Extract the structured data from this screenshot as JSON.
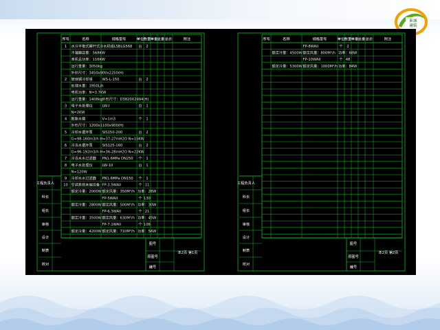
{
  "logo": {
    "line1": "新城",
    "line2": "建筑"
  },
  "left_sheet": {
    "headers": [
      "序号",
      "名称",
      "规格型号",
      "单位",
      "数量",
      "单重",
      "总重",
      "总价",
      "附注"
    ],
    "rows": [
      [
        "1",
        "水冷平衡式螺杆式冷水机组LSBLG568",
        "",
        "台",
        "2",
        "",
        "",
        "",
        ""
      ],
      [
        "",
        "冷凝器容量：568KW",
        "",
        "",
        "",
        "",
        "",
        "",
        ""
      ],
      [
        "",
        "单机总功率：116KW",
        "",
        "",
        "",
        "",
        "",
        "",
        ""
      ],
      [
        "",
        "运行重量：3050kg",
        "",
        "",
        "",
        "",
        "",
        "",
        ""
      ],
      [
        "",
        "外形尺寸：3450x800x2250(H)",
        "",
        "",
        "",
        "",
        "",
        "",
        ""
      ],
      [
        "2",
        "玻璃钢冷却塔",
        "WS-L-150",
        "台",
        "2",
        "",
        "",
        "",
        ""
      ],
      [
        "",
        "处理水量：1950L/h",
        "",
        "",
        "",
        "",
        "",
        "",
        ""
      ],
      [
        "",
        "电机功率：N=3.7KW",
        "",
        "",
        "",
        "",
        "",
        "",
        ""
      ],
      [
        "",
        "运行重量：1408kg",
        "外形尺寸：D3820X2994(H)",
        "",
        "",
        "",
        "",
        "",
        ""
      ],
      [
        "3",
        "电子水处理仪",
        "LW-I",
        "台",
        "1",
        "",
        "",
        "",
        ""
      ],
      [
        "",
        "N=2KW",
        "",
        "",
        "",
        "",
        "",
        "",
        ""
      ],
      [
        "4",
        "膨胀水箱",
        "V=1m3",
        "个",
        "1",
        "",
        "",
        "",
        ""
      ],
      [
        "",
        "外形尺寸：1200x1100x900(H)",
        "",
        "",
        "",
        "",
        "",
        "",
        ""
      ],
      [
        "5",
        "冷却水循环泵",
        "SIS150-200",
        "台",
        "2",
        "",
        "",
        "",
        ""
      ],
      [
        "",
        "G=98-160m3/h H=37-27mH2O N=15KW",
        "",
        "",
        "",
        "",
        "",
        "",
        ""
      ],
      [
        "6",
        "冷冻水循环泵",
        "SIS125-160",
        "台",
        "2",
        "",
        "",
        "",
        ""
      ],
      [
        "",
        "G=96-192m3/h H=36-28mH2O N=22KW",
        "",
        "",
        "",
        "",
        "",
        "",
        ""
      ],
      [
        "7",
        "冷冻水水过滤器",
        "PN1.6MPa DN250",
        "个",
        "1",
        "",
        "",
        "",
        ""
      ],
      [
        "8",
        "电子水处理仪",
        "LW-10",
        "台",
        "1",
        "",
        "",
        "",
        ""
      ],
      [
        "",
        "N=120W",
        "",
        "",
        "",
        "",
        "",
        "",
        ""
      ],
      [
        "9",
        "冷却水水过滤器",
        "PN1.6MPa DN150",
        "个",
        "1",
        "",
        "",
        "",
        ""
      ],
      [
        "10",
        "空调系统末端设备",
        "FP-3.5WAII",
        "个",
        "11",
        "",
        "",
        "",
        ""
      ],
      [
        "",
        "额定冷量：2000W",
        "额定风量：350M³/h",
        "功率：28W",
        "",
        "",
        "",
        "",
        ""
      ],
      [
        "",
        "",
        "FP-5WAII",
        "个",
        "130",
        "",
        "",
        "",
        ""
      ],
      [
        "",
        "额定冷量：2800W",
        "额定风量：500M³/h",
        "功率：30W",
        "",
        "",
        "",
        "",
        ""
      ],
      [
        "",
        "",
        "FP-6.3WAII",
        "个",
        "21",
        "",
        "",
        "",
        ""
      ],
      [
        "",
        "额定冷量：3500W",
        "额定风量：630M³/h",
        "功率：45W",
        "",
        "",
        "",
        "",
        ""
      ],
      [
        "",
        "",
        "FP-7.1WAII",
        "个",
        "106",
        "",
        "",
        "",
        ""
      ],
      [
        "",
        "额定冷量：4200W",
        "额定风量：710M³/h",
        "功率：56W",
        "",
        "",
        "",
        "",
        ""
      ]
    ],
    "side_labels": [
      "工程负责人",
      "科长",
      "组长",
      "审核",
      "设计",
      "制表",
      "校对"
    ],
    "footer": {
      "drawing_name": "图号",
      "project_no": "原图号",
      "serial": "编号",
      "page": "本2页  第1页"
    }
  },
  "right_sheet": {
    "headers": [
      "序号",
      "名称",
      "规格型号",
      "单位",
      "数量",
      "单重",
      "总重",
      "总价",
      "附注"
    ],
    "rows": [
      [
        "",
        "",
        "FP-8WAII",
        "个",
        "2",
        "",
        "",
        "",
        ""
      ],
      [
        "",
        "额定冷量：4500W",
        "额定风量：800M³/h",
        "功率：68W",
        "",
        "",
        "",
        "",
        ""
      ],
      [
        "",
        "",
        "FP-10WAII",
        "个",
        "48",
        "",
        "",
        "",
        ""
      ],
      [
        "",
        "额定冷量：5300W",
        "额定风量：1000M³/h",
        "功率：84W",
        "",
        "",
        "",
        "",
        ""
      ]
    ],
    "side_labels": [
      "工程负责人",
      "科长",
      "组长",
      "审核",
      "设计",
      "制表",
      "校对"
    ],
    "footer": {
      "drawing_name": "图号",
      "project_no": "原图号",
      "serial": "编号",
      "page": "本2页  第2页"
    }
  }
}
